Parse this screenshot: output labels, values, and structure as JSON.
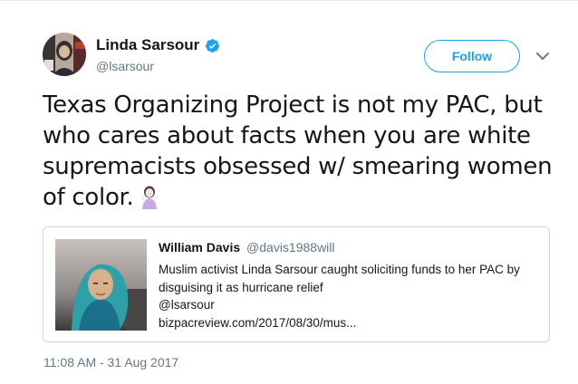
{
  "author": {
    "name": "Linda Sarsour",
    "handle": "@lsarsour",
    "avatar_icon": "profile-photo",
    "verified_icon": "verified-badge-icon"
  },
  "actions": {
    "follow_label": "Follow",
    "menu_icon": "chevron-down-icon"
  },
  "tweet": {
    "text": "Texas Organizing Project is not my PAC, but who cares about facts when you are white supremacists obsessed w/ smearing women of color.",
    "emoji_icon": "woman-shrugging-emoji",
    "timestamp": "11:08 AM - 31 Aug 2017"
  },
  "quoted": {
    "name": "William Davis",
    "handle": "@davis1988will",
    "lines": [
      "Muslim activist Linda Sarsour caught soliciting funds to her PAC by",
      "disguising it as hurricane relief",
      "@lsarsour",
      "bizpacreview.com/2017/08/30/mus..."
    ]
  },
  "colors": {
    "accent": "#1da1f2",
    "text": "#14171a",
    "muted": "#657786",
    "border": "#ccd6dd"
  }
}
